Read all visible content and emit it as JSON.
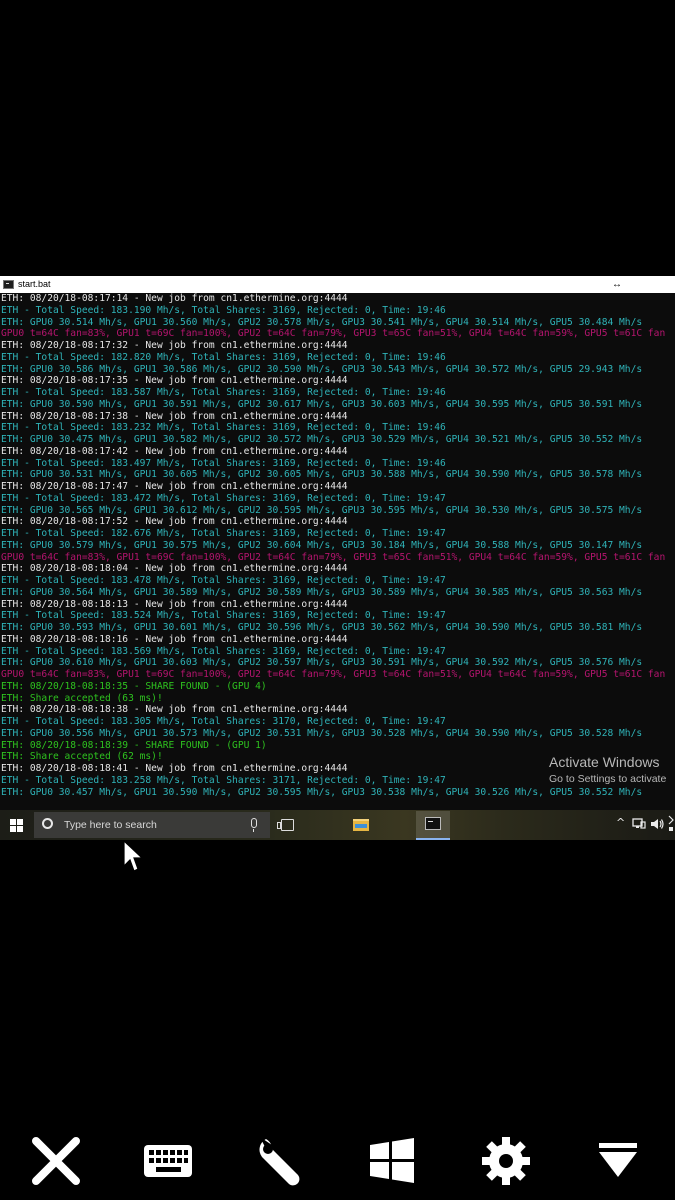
{
  "window": {
    "title": "start.bat",
    "resize_glyph": "↔"
  },
  "console_lines": [
    {
      "text": "ETH: 08/20/18-08:17:14 - New job from cn1.ethermine.org:4444",
      "color": "white"
    },
    {
      "text": "ETH - Total Speed: 183.190 Mh/s, Total Shares: 3169, Rejected: 0, Time: 19:46",
      "color": "cyan"
    },
    {
      "text": "ETH: GPU0 30.514 Mh/s, GPU1 30.560 Mh/s, GPU2 30.578 Mh/s, GPU3 30.541 Mh/s, GPU4 30.514 Mh/s, GPU5 30.484 Mh/s",
      "color": "cyan"
    },
    {
      "text": "GPU0 t=64C fan=83%, GPU1 t=69C fan=100%, GPU2 t=64C fan=79%, GPU3 t=65C fan=51%, GPU4 t=64C fan=59%, GPU5 t=61C fan",
      "color": "magenta"
    },
    {
      "text": "ETH: 08/20/18-08:17:32 - New job from cn1.ethermine.org:4444",
      "color": "white"
    },
    {
      "text": "ETH - Total Speed: 182.820 Mh/s, Total Shares: 3169, Rejected: 0, Time: 19:46",
      "color": "cyan"
    },
    {
      "text": "ETH: GPU0 30.586 Mh/s, GPU1 30.586 Mh/s, GPU2 30.590 Mh/s, GPU3 30.543 Mh/s, GPU4 30.572 Mh/s, GPU5 29.943 Mh/s",
      "color": "cyan"
    },
    {
      "text": "ETH: 08/20/18-08:17:35 - New job from cn1.ethermine.org:4444",
      "color": "white"
    },
    {
      "text": "ETH - Total Speed: 183.587 Mh/s, Total Shares: 3169, Rejected: 0, Time: 19:46",
      "color": "cyan"
    },
    {
      "text": "ETH: GPU0 30.590 Mh/s, GPU1 30.591 Mh/s, GPU2 30.617 Mh/s, GPU3 30.603 Mh/s, GPU4 30.595 Mh/s, GPU5 30.591 Mh/s",
      "color": "cyan"
    },
    {
      "text": "ETH: 08/20/18-08:17:38 - New job from cn1.ethermine.org:4444",
      "color": "white"
    },
    {
      "text": "ETH - Total Speed: 183.232 Mh/s, Total Shares: 3169, Rejected: 0, Time: 19:46",
      "color": "cyan"
    },
    {
      "text": "ETH: GPU0 30.475 Mh/s, GPU1 30.582 Mh/s, GPU2 30.572 Mh/s, GPU3 30.529 Mh/s, GPU4 30.521 Mh/s, GPU5 30.552 Mh/s",
      "color": "cyan"
    },
    {
      "text": "ETH: 08/20/18-08:17:42 - New job from cn1.ethermine.org:4444",
      "color": "white"
    },
    {
      "text": "ETH - Total Speed: 183.497 Mh/s, Total Shares: 3169, Rejected: 0, Time: 19:46",
      "color": "cyan"
    },
    {
      "text": "ETH: GPU0 30.531 Mh/s, GPU1 30.605 Mh/s, GPU2 30.605 Mh/s, GPU3 30.588 Mh/s, GPU4 30.590 Mh/s, GPU5 30.578 Mh/s",
      "color": "cyan"
    },
    {
      "text": "ETH: 08/20/18-08:17:47 - New job from cn1.ethermine.org:4444",
      "color": "white"
    },
    {
      "text": "ETH - Total Speed: 183.472 Mh/s, Total Shares: 3169, Rejected: 0, Time: 19:47",
      "color": "cyan"
    },
    {
      "text": "ETH: GPU0 30.565 Mh/s, GPU1 30.612 Mh/s, GPU2 30.595 Mh/s, GPU3 30.595 Mh/s, GPU4 30.530 Mh/s, GPU5 30.575 Mh/s",
      "color": "cyan"
    },
    {
      "text": "ETH: 08/20/18-08:17:52 - New job from cn1.ethermine.org:4444",
      "color": "white"
    },
    {
      "text": "ETH - Total Speed: 182.676 Mh/s, Total Shares: 3169, Rejected: 0, Time: 19:47",
      "color": "cyan"
    },
    {
      "text": "ETH: GPU0 30.579 Mh/s, GPU1 30.575 Mh/s, GPU2 30.604 Mh/s, GPU3 30.184 Mh/s, GPU4 30.588 Mh/s, GPU5 30.147 Mh/s",
      "color": "cyan"
    },
    {
      "text": "GPU0 t=64C fan=83%, GPU1 t=69C fan=100%, GPU2 t=64C fan=79%, GPU3 t=65C fan=51%, GPU4 t=64C fan=59%, GPU5 t=61C fan",
      "color": "magenta"
    },
    {
      "text": "ETH: 08/20/18-08:18:04 - New job from cn1.ethermine.org:4444",
      "color": "white"
    },
    {
      "text": "ETH - Total Speed: 183.478 Mh/s, Total Shares: 3169, Rejected: 0, Time: 19:47",
      "color": "cyan"
    },
    {
      "text": "ETH: GPU0 30.564 Mh/s, GPU1 30.589 Mh/s, GPU2 30.589 Mh/s, GPU3 30.589 Mh/s, GPU4 30.585 Mh/s, GPU5 30.563 Mh/s",
      "color": "cyan"
    },
    {
      "text": "ETH: 08/20/18-08:18:13 - New job from cn1.ethermine.org:4444",
      "color": "white"
    },
    {
      "text": "ETH - Total Speed: 183.524 Mh/s, Total Shares: 3169, Rejected: 0, Time: 19:47",
      "color": "cyan"
    },
    {
      "text": "ETH: GPU0 30.593 Mh/s, GPU1 30.601 Mh/s, GPU2 30.596 Mh/s, GPU3 30.562 Mh/s, GPU4 30.590 Mh/s, GPU5 30.581 Mh/s",
      "color": "cyan"
    },
    {
      "text": "ETH: 08/20/18-08:18:16 - New job from cn1.ethermine.org:4444",
      "color": "white"
    },
    {
      "text": "ETH - Total Speed: 183.569 Mh/s, Total Shares: 3169, Rejected: 0, Time: 19:47",
      "color": "cyan"
    },
    {
      "text": "ETH: GPU0 30.610 Mh/s, GPU1 30.603 Mh/s, GPU2 30.597 Mh/s, GPU3 30.591 Mh/s, GPU4 30.592 Mh/s, GPU5 30.576 Mh/s",
      "color": "cyan"
    },
    {
      "text": "GPU0 t=64C fan=83%, GPU1 t=69C fan=100%, GPU2 t=64C fan=79%, GPU3 t=64C fan=51%, GPU4 t=64C fan=59%, GPU5 t=61C fan",
      "color": "magenta"
    },
    {
      "text": "ETH: 08/20/18-08:18:35 - SHARE FOUND - (GPU 4)",
      "color": "green"
    },
    {
      "text": "ETH: Share accepted (63 ms)!",
      "color": "green"
    },
    {
      "text": "ETH: 08/20/18-08:18:38 - New job from cn1.ethermine.org:4444",
      "color": "white"
    },
    {
      "text": "ETH - Total Speed: 183.305 Mh/s, Total Shares: 3170, Rejected: 0, Time: 19:47",
      "color": "cyan"
    },
    {
      "text": "ETH: GPU0 30.556 Mh/s, GPU1 30.573 Mh/s, GPU2 30.531 Mh/s, GPU3 30.528 Mh/s, GPU4 30.590 Mh/s, GPU5 30.528 Mh/s",
      "color": "cyan"
    },
    {
      "text": "ETH: 08/20/18-08:18:39 - SHARE FOUND - (GPU 1)",
      "color": "green"
    },
    {
      "text": "ETH: Share accepted (62 ms)!",
      "color": "green"
    },
    {
      "text": "ETH: 08/20/18-08:18:41 - New job from cn1.ethermine.org:4444",
      "color": "white"
    },
    {
      "text": "ETH - Total Speed: 183.258 Mh/s, Total Shares: 3171, Rejected: 0, Time: 19:47",
      "color": "cyan"
    },
    {
      "text": "ETH: GPU0 30.457 Mh/s, GPU1 30.590 Mh/s, GPU2 30.595 Mh/s, GPU3 30.538 Mh/s, GPU4 30.526 Mh/s, GPU5 30.552 Mh/s",
      "color": "cyan"
    }
  ],
  "watermark": {
    "title": "Activate Windows",
    "subtitle": "Go to Settings to activate"
  },
  "taskbar": {
    "search_placeholder": "Type here to search",
    "tray_glyphs": "^"
  },
  "bottom_toolbar": {
    "icons": [
      "close-icon",
      "keyboard-icon",
      "wrench-icon",
      "windows-icon",
      "gear-icon",
      "dropdown-icon"
    ]
  }
}
